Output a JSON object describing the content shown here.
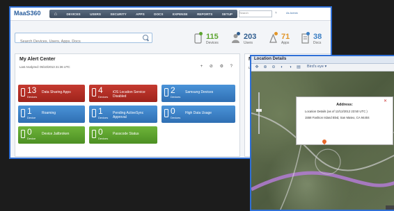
{
  "header": {
    "logo_text": "MaaS360",
    "nav": [
      "DEVICES",
      "USERS",
      "SECURITY",
      "APPS",
      "DOCS",
      "EXPENSE",
      "REPORTS",
      "SETUP"
    ],
    "search_placeholder": "Search",
    "help": "?",
    "user": "Ak Admin",
    "sub": "Update"
  },
  "search": {
    "placeholder": "Search Devices, Users, Apps, Docs"
  },
  "stats": [
    {
      "value": "115",
      "label": "Devices"
    },
    {
      "value": "203",
      "label": "Users"
    },
    {
      "value": "71",
      "label": "Apps"
    },
    {
      "value": "38",
      "label": "Docs"
    }
  ],
  "alert_center": {
    "title": "My Alert Center",
    "analyzed": "Last Analyzed: 05/10/2013 21:36 UTC",
    "tools": "+ ⊘ ⚙ ?",
    "tiles": [
      {
        "count": "13",
        "unit": "Devices",
        "label": "Data Sharing Apps",
        "color": "red"
      },
      {
        "count": "4",
        "unit": "Devices",
        "label": "iOS Location Service Disabled",
        "color": "red"
      },
      {
        "count": "2",
        "unit": "Devices",
        "label": "Samsung Devices",
        "color": "blue"
      },
      {
        "count": "1",
        "unit": "Device",
        "label": "Roaming",
        "color": "blue"
      },
      {
        "count": "1",
        "unit": "Devices",
        "label": "Pending ActiveSync Approval",
        "color": "blue"
      },
      {
        "count": "0",
        "unit": "Devices",
        "label": "High Data Usage",
        "color": "blue"
      },
      {
        "count": "0",
        "unit": "Device",
        "label": "Device Jailbroken",
        "color": "green"
      },
      {
        "count": "0",
        "unit": "Devices",
        "label": "Passcode Status",
        "color": "green"
      }
    ]
  },
  "right_panel": {
    "title": "My",
    "label": "Last"
  },
  "location_window": {
    "title": "Location Details",
    "birds_eye": "Bird's eye ▾",
    "popup": {
      "title": "Address:",
      "line1": "Location Details (as of 12/12/2012 23:50 UTC )",
      "line2": "1558 Fashion Island Blvd, San Mateo, CA 94404",
      "close": "✕"
    }
  },
  "colors": {
    "red": "#b22e25",
    "blue": "#3d84c9",
    "green": "#5fa22e",
    "frame": "#2f6fd6"
  }
}
